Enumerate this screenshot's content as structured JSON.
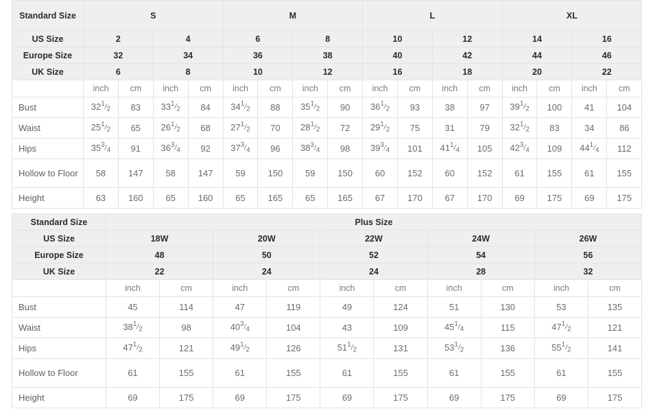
{
  "standard_table": {
    "label_col_header": "Standard Size",
    "group_headers": [
      "S",
      "M",
      "L",
      "XL"
    ],
    "rows": [
      {
        "label": "US Size",
        "values": [
          "2",
          "4",
          "6",
          "8",
          "10",
          "12",
          "14",
          "16"
        ]
      },
      {
        "label": "Europe Size",
        "values": [
          "32",
          "34",
          "36",
          "38",
          "40",
          "42",
          "44",
          "46"
        ]
      },
      {
        "label": "UK Size",
        "values": [
          "6",
          "8",
          "10",
          "12",
          "16",
          "18",
          "20",
          "22"
        ]
      }
    ],
    "unit_row": {
      "label": "",
      "units": [
        "inch",
        "cm",
        "inch",
        "cm",
        "inch",
        "cm",
        "inch",
        "cm",
        "inch",
        "cm",
        "inch",
        "cm",
        "inch",
        "cm",
        "inch",
        "cm"
      ]
    },
    "measure_rows": [
      {
        "label": "Bust",
        "values": [
          "32 1/2",
          "83",
          "33 1/2",
          "84",
          "34 1/2",
          "88",
          "35 1/2",
          "90",
          "36 1/2",
          "93",
          "38",
          "97",
          "39 1/2",
          "100",
          "41",
          "104"
        ]
      },
      {
        "label": "Waist",
        "values": [
          "25 1/2",
          "65",
          "26 1/2",
          "68",
          "27 1/2",
          "70",
          "28 1/2",
          "72",
          "29 1/2",
          "75",
          "31",
          "79",
          "32 1/2",
          "83",
          "34",
          "86"
        ]
      },
      {
        "label": "Hips",
        "values": [
          "35 3/4",
          "91",
          "36 3/4",
          "92",
          "37 3/4",
          "96",
          "38 3/4",
          "98",
          "39 3/4",
          "101",
          "41 1/4",
          "105",
          "42 3/4",
          "109",
          "44 1/4",
          "112"
        ]
      },
      {
        "label": "Hollow to Floor",
        "values": [
          "58",
          "147",
          "58",
          "147",
          "59",
          "150",
          "59",
          "150",
          "60",
          "152",
          "60",
          "152",
          "61",
          "155",
          "61",
          "155"
        ]
      },
      {
        "label": "Height",
        "values": [
          "63",
          "160",
          "65",
          "160",
          "65",
          "165",
          "65",
          "165",
          "67",
          "170",
          "67",
          "170",
          "69",
          "175",
          "69",
          "175"
        ]
      }
    ]
  },
  "plus_table": {
    "label_col_header": "Standard Size",
    "group_header": "Plus Size",
    "rows": [
      {
        "label": "US Size",
        "values": [
          "18W",
          "20W",
          "22W",
          "24W",
          "26W"
        ]
      },
      {
        "label": "Europe Size",
        "values": [
          "48",
          "50",
          "52",
          "54",
          "56"
        ]
      },
      {
        "label": "UK Size",
        "values": [
          "22",
          "24",
          "24",
          "28",
          "32"
        ]
      }
    ],
    "unit_row": {
      "label": "",
      "units": [
        "inch",
        "cm",
        "inch",
        "cm",
        "inch",
        "cm",
        "inch",
        "cm",
        "inch",
        "cm"
      ]
    },
    "measure_rows": [
      {
        "label": "Bust",
        "values": [
          "45",
          "114",
          "47",
          "119",
          "49",
          "124",
          "51",
          "130",
          "53",
          "135"
        ]
      },
      {
        "label": "Waist",
        "values": [
          "38 1/2",
          "98",
          "40 3/4",
          "104",
          "43",
          "109",
          "45 1/4",
          "115",
          "47 1/2",
          "121"
        ]
      },
      {
        "label": "Hips",
        "values": [
          "47 1/2",
          "121",
          "49 1/2",
          "126",
          "51 1/2",
          "131",
          "53 1/2",
          "136",
          "55 1/2",
          "141"
        ]
      },
      {
        "label": "Hollow to Floor",
        "values": [
          "61",
          "155",
          "61",
          "155",
          "61",
          "155",
          "61",
          "155",
          "61",
          "155"
        ]
      },
      {
        "label": "Height",
        "values": [
          "69",
          "175",
          "69",
          "175",
          "69",
          "175",
          "69",
          "175",
          "69",
          "175"
        ]
      }
    ]
  },
  "colors": {
    "header_bg": "#efefef",
    "body_bg": "#ffffff",
    "header_text": "#2b2b2b",
    "body_text": "#6b6b6b",
    "grid_line": "#e6e6e6"
  }
}
